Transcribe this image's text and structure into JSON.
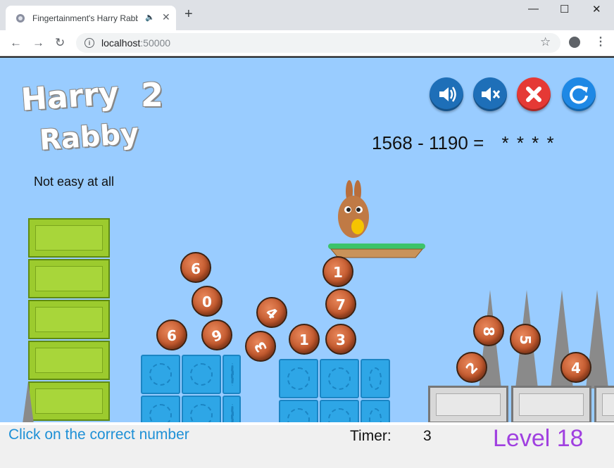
{
  "browser": {
    "tab_title": "Fingertainment's Harry Rabb",
    "audio_icon": "speaker-icon",
    "new_tab": "+",
    "url_host": "localhost",
    "url_port": ":50000",
    "minimize": "—",
    "maximize": "☐",
    "close": "✕"
  },
  "game": {
    "logo_line1": "Harry",
    "logo_number": "2",
    "logo_line2": "Rabby",
    "difficulty": "Not easy at all",
    "equation": "1568 - 1190 =",
    "answer_mask": "* * * *",
    "controls": [
      {
        "name": "sound-on",
        "color": "#1e6fb8"
      },
      {
        "name": "sound-off",
        "color": "#1e6fb8"
      },
      {
        "name": "close",
        "color": "#e53935"
      },
      {
        "name": "restart",
        "color": "#1e88e5"
      }
    ],
    "coins": [
      "9",
      "0",
      "6",
      "9",
      "4",
      "3",
      "1",
      "7",
      "1",
      "3",
      "8",
      "5",
      "2",
      "4"
    ]
  },
  "status": {
    "instruction": "Click on the correct number",
    "timer_label": "Timer:",
    "timer_value": "3",
    "level": "Level 18"
  }
}
